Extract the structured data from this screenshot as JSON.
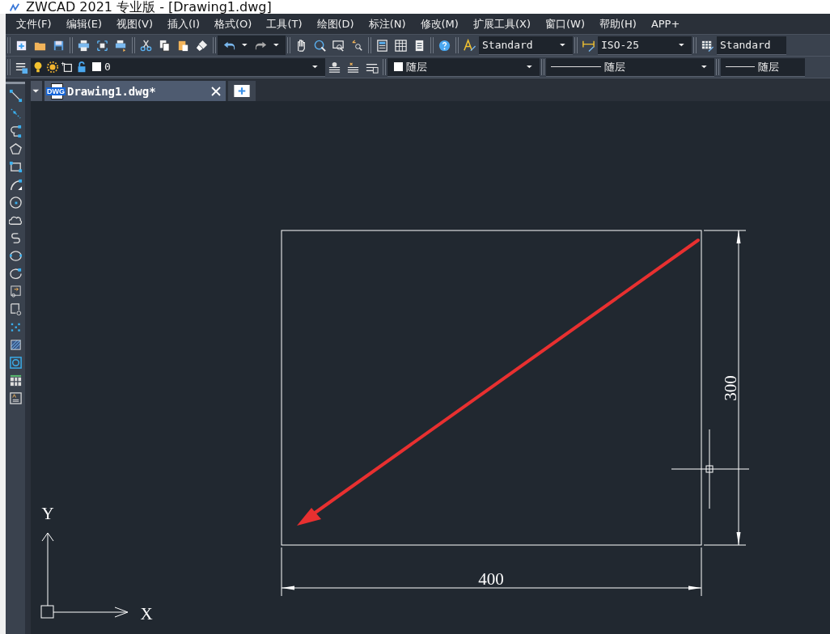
{
  "window": {
    "title": "ZWCAD 2021 专业版 - [Drawing1.dwg]"
  },
  "menu": [
    "文件(F)",
    "编辑(E)",
    "视图(V)",
    "插入(I)",
    "格式(O)",
    "工具(T)",
    "绘图(D)",
    "标注(N)",
    "修改(M)",
    "扩展工具(X)",
    "窗口(W)",
    "帮助(H)",
    "APP+"
  ],
  "style_toolbar": [
    {
      "kind": "text-style",
      "value": "Standard"
    },
    {
      "kind": "dim-style",
      "value": "ISO-25"
    },
    {
      "kind": "table-style",
      "value": "Standard"
    }
  ],
  "layer_toolbar": {
    "layer": "0",
    "color_setting": "随层",
    "linetype": "随层",
    "lineweight": "随层"
  },
  "tabs": [
    {
      "label": "Drawing1.dwg*",
      "selected": true,
      "file_badge": "DWG"
    }
  ],
  "canvas": {
    "width_dimension": "400",
    "height_dimension": "300",
    "x_axis": "X",
    "y_axis": "Y"
  }
}
